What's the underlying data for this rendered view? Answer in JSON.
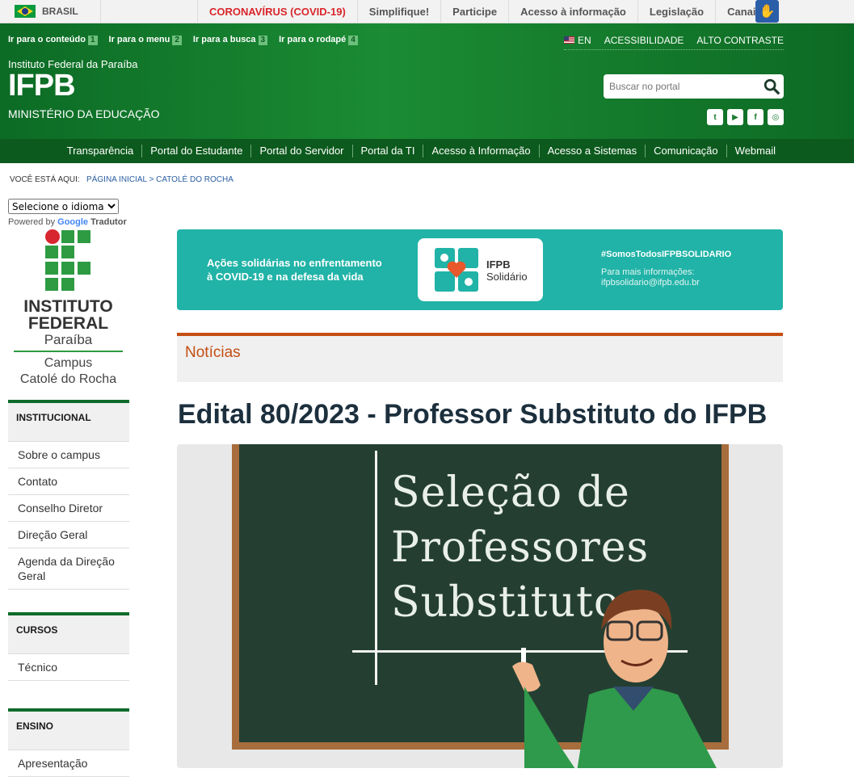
{
  "gov_bar": {
    "country": "BRASIL",
    "links": [
      "CORONAVÍRUS (COVID-19)",
      "Simplifique!",
      "Participe",
      "Acesso à informação",
      "Legislação",
      "Canais"
    ]
  },
  "header": {
    "access_links": [
      {
        "label": "Ir para o conteúdo",
        "key": "1"
      },
      {
        "label": "Ir para o menu",
        "key": "2"
      },
      {
        "label": "Ir para a busca",
        "key": "3"
      },
      {
        "label": "Ir para o rodapé",
        "key": "4"
      }
    ],
    "lang": "EN",
    "acessibilidade": "ACESSIBILIDADE",
    "alto_contraste": "ALTO CONTRASTE",
    "institution_small": "Instituto Federal da Paraíba",
    "institution_big": "IFPB",
    "ministry": "MINISTÉRIO DA EDUCAÇÃO",
    "search_placeholder": "Buscar no portal",
    "social": [
      "twitter-icon",
      "youtube-icon",
      "facebook-icon",
      "instagram-icon"
    ]
  },
  "nav": [
    "Transparência",
    "Portal do Estudante",
    "Portal do Servidor",
    "Portal da TI",
    "Acesso à Informação",
    "Acesso a Sistemas",
    "Comunicação",
    "Webmail"
  ],
  "breadcrumb": {
    "prefix": "VOCÊ ESTÁ AQUI:",
    "items": [
      "PÁGINA INICIAL",
      "CATOLÉ DO ROCHA"
    ]
  },
  "translate": {
    "select_label": "Selecione o idioma",
    "powered_prefix": "Powered by",
    "google": "Google",
    "tradutor": "Tradutor"
  },
  "logo": {
    "line1": "INSTITUTO",
    "line2": "FEDERAL",
    "line3": "Paraíba",
    "campus1": "Campus",
    "campus2": "Catolé do Rocha"
  },
  "sidebar": {
    "institucional": {
      "title": "INSTITUCIONAL",
      "items": [
        "Sobre o campus",
        "Contato",
        "Conselho Diretor",
        "Direção Geral",
        "Agenda da Direção Geral"
      ]
    },
    "cursos": {
      "title": "CURSOS",
      "items": [
        "Técnico"
      ]
    },
    "ensino": {
      "title": "ENSINO",
      "items": [
        "Apresentação"
      ]
    }
  },
  "banner": {
    "left_line1": "Ações solidárias  no enfrentamento",
    "left_line2": "à COVID-19 e na defesa da vida",
    "card_title": "IFPB",
    "card_sub": "Solidário",
    "hashtag": "#SomosTodosIFPBSOLIDARIO",
    "info_line1": "Para mais informações:",
    "info_line2": "ifpbsolidario@ifpb.edu.br"
  },
  "news_section": "Notícias",
  "article": {
    "title": "Edital 80/2023 - Professor Substituto do IFPB",
    "board_line1": "Seleção de",
    "board_line2": "Professores",
    "board_line3": "Substitutos"
  }
}
